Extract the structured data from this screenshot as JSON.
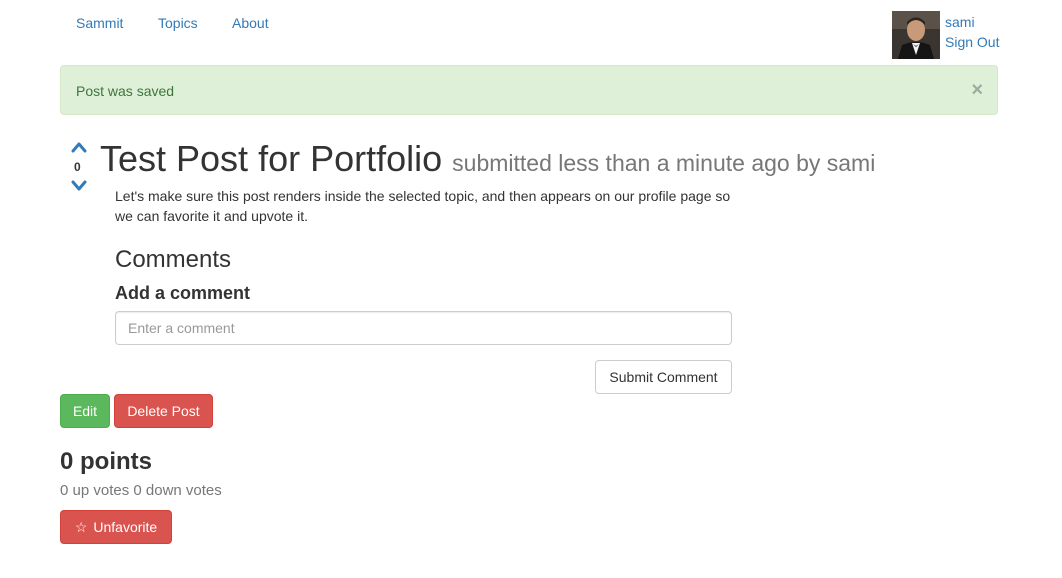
{
  "nav": {
    "brand": "Sammit",
    "topics": "Topics",
    "about": "About"
  },
  "user": {
    "name": "sami",
    "sign_out": "Sign Out"
  },
  "alert": {
    "message": "Post was saved",
    "close_symbol": "×"
  },
  "vote": {
    "count": "0"
  },
  "post": {
    "title": "Test Post for Portfolio",
    "meta": "submitted less than a minute ago by sami",
    "body": "Let's make sure this post renders inside the selected topic, and then appears on our profile page so we can favorite it and upvote it."
  },
  "comments": {
    "heading": "Comments",
    "add_label": "Add a comment",
    "placeholder": "Enter a comment",
    "submit_label": "Submit Comment"
  },
  "actions": {
    "edit_label": "Edit",
    "delete_label": "Delete Post"
  },
  "stats": {
    "points": "0 points",
    "votes": "0 up votes 0 down votes"
  },
  "favorite": {
    "icon": "star-outline-icon",
    "star_glyph": "☆",
    "label": "Unfavorite"
  },
  "colors": {
    "link": "#337ab7",
    "success_bg": "#dff0d8",
    "success_text": "#3c763d",
    "edit_green": "#5cb85c",
    "danger_red": "#d9534f"
  }
}
